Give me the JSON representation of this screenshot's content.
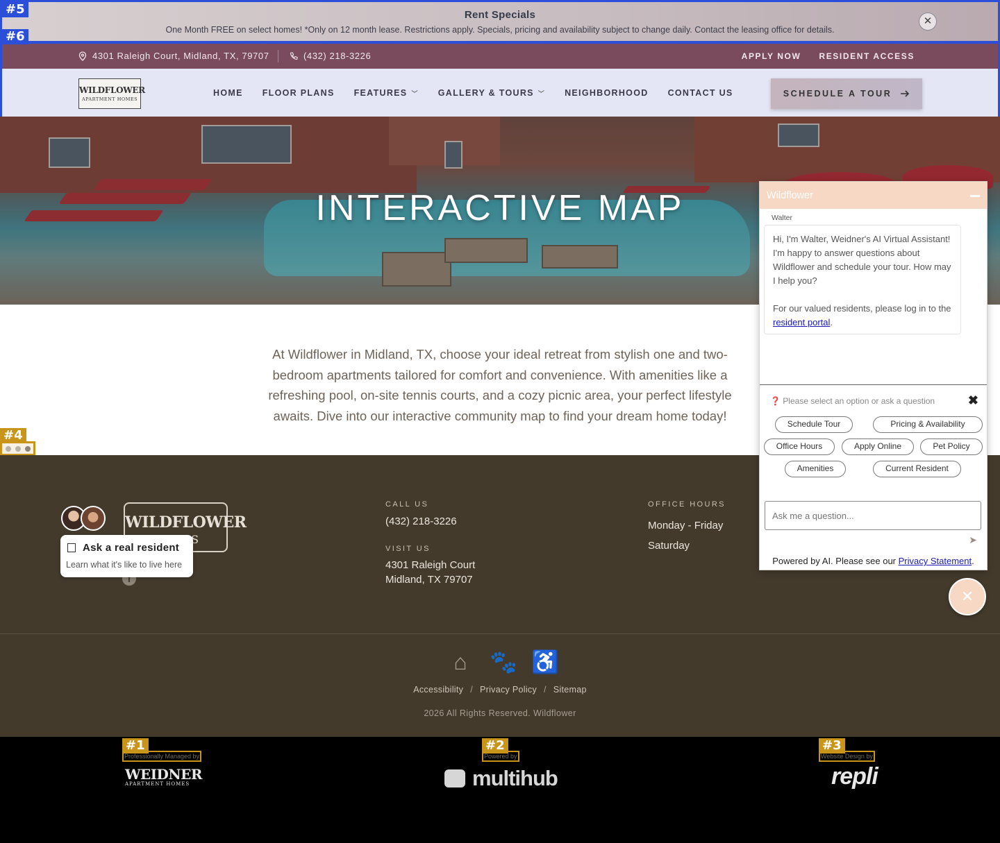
{
  "annotations": {
    "a1": "#1",
    "a2": "#2",
    "a3": "#3",
    "a4": "#4",
    "a5": "#5",
    "a6": "#6"
  },
  "rent_specials": {
    "title": "Rent Specials",
    "description": "One Month FREE on select homes! *Only on 12 month lease. Restrictions apply. Specials, pricing and availability subject to change daily. Contact the leasing office for details.",
    "close_glyph": "✕"
  },
  "top_bar": {
    "address": "4301 Raleigh Court, Midland, TX, 79707",
    "phone": "(432) 218-3226",
    "apply_now": "APPLY NOW",
    "resident_access": "RESIDENT ACCESS"
  },
  "logo": {
    "line1": "WILDFLOWER",
    "line2": "APARTMENT HOMES"
  },
  "nav": {
    "home": "HOME",
    "floor_plans": "FLOOR PLANS",
    "features": "FEATURES",
    "gallery": "GALLERY & TOURS",
    "neighborhood": "NEIGHBORHOOD",
    "contact": "CONTACT US",
    "schedule_tour": "SCHEDULE A TOUR"
  },
  "hero": {
    "title": "INTERACTIVE MAP"
  },
  "intro": "At Wildflower in Midland, TX, choose your ideal retreat from stylish one and two-bedroom apartments tailored for comfort and convenience. With amenities like a refreshing pool, on-site tennis courts, and a cozy picnic area, your perfect lifestyle awaits. Dive into our interactive community map to find your dream home today!",
  "footer": {
    "logo_line1": "WILDFLOWER",
    "logo_line2": "HOMES",
    "call_label": "CALL US",
    "call_value": "(432) 218-3226",
    "visit_label": "VISIT US",
    "visit_line1": "4301 Raleigh Court",
    "visit_line2": "Midland, TX 79707",
    "hours_label": "OFFICE HOURS",
    "hours_line1": "Monday - Friday",
    "hours_line2": "Saturday",
    "ask_title": "Ask a real resident",
    "ask_sub": "Learn what it's like to live here",
    "legal": {
      "accessibility": "Accessibility",
      "privacy": "Privacy Policy",
      "sitemap": "Sitemap",
      "slash": "/"
    },
    "copyright": "2026 All Rights Reserved. Wildflower"
  },
  "credits": {
    "managed_label": "Professionally Managed by",
    "weidner_name": "WEIDNER",
    "weidner_sub": "APARTMENT HOMES",
    "powered_label": "Powered by",
    "multihub_name": "multihub",
    "design_label": "Website Design by",
    "repli_name": "repli"
  },
  "chat": {
    "title": "Wildflower",
    "agent": "Walter",
    "message_1": "Hi, I'm Walter, Weidner's AI Virtual Assistant! I'm happy to answer questions about Wildflower and schedule your tour. How may I help you?",
    "message_2_prefix": "For our valued residents, please log in to the",
    "message_2_link": "resident portal",
    "message_2_suffix": ".",
    "prompt": "Please select an option or ask a question",
    "options": {
      "schedule_tour": "Schedule Tour",
      "pricing": "Pricing & Availability",
      "office_hours": "Office Hours",
      "apply_online": "Apply Online",
      "pet_policy": "Pet Policy",
      "amenities": "Amenities",
      "current_resident": "Current Resident"
    },
    "input_placeholder": "Ask me a question...",
    "footer_prefix": "Powered by AI. Please see our",
    "footer_link": "Privacy Statement",
    "footer_suffix": "."
  },
  "colors": {
    "top_bar": "#7a4b5c",
    "nav_bg": "#e4e6f6",
    "footer_bg": "#433a2c",
    "chat_accent": "#f7d8c4",
    "annotation_blue": "#2b4fd8",
    "annotation_gold": "#c8941a"
  }
}
